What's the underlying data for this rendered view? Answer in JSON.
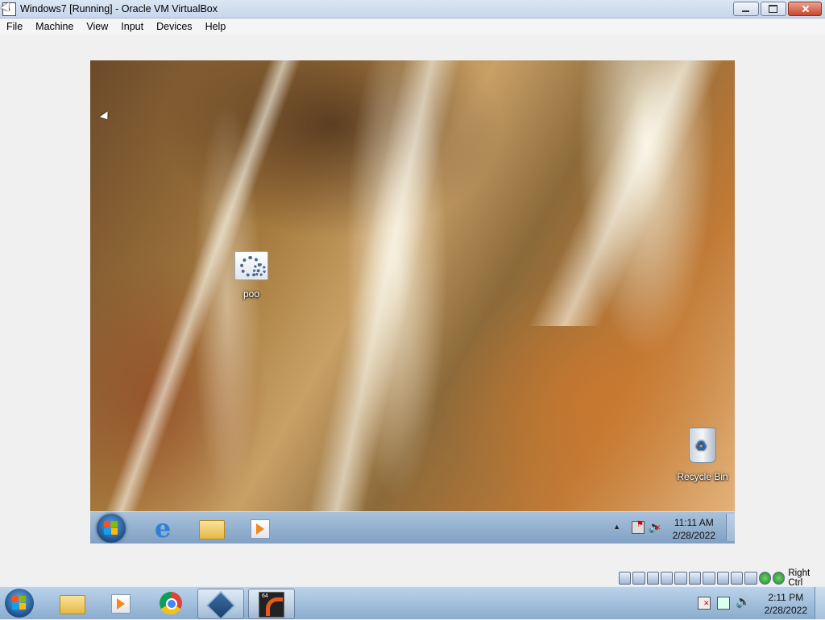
{
  "window": {
    "title": "Windows7 [Running] - Oracle VM VirtualBox"
  },
  "menubar": {
    "items": [
      "File",
      "Machine",
      "View",
      "Input",
      "Devices",
      "Help"
    ]
  },
  "guest": {
    "desktop_icons": [
      {
        "label": "poo",
        "icon": "settings-gear-icon"
      },
      {
        "label": "Recycle Bin",
        "icon": "recycle-bin-icon"
      }
    ],
    "taskbar": {
      "pinned": [
        "start-orb-icon",
        "internet-explorer-icon",
        "folder-icon",
        "media-player-icon"
      ],
      "clock_time": "11:11 AM",
      "clock_date": "2/28/2022"
    }
  },
  "statusbar": {
    "host_key_label": "Right Ctrl"
  },
  "host_taskbar": {
    "pinned": [
      "start-orb-icon",
      "folder-icon",
      "media-player-icon",
      "chrome-icon",
      "virtualbox-icon",
      "terminal-icon"
    ],
    "clock_time": "2:11 PM",
    "clock_date": "2/28/2022"
  },
  "colors": {
    "taskbar": "#8aaccd",
    "close_button": "#c9462c"
  }
}
